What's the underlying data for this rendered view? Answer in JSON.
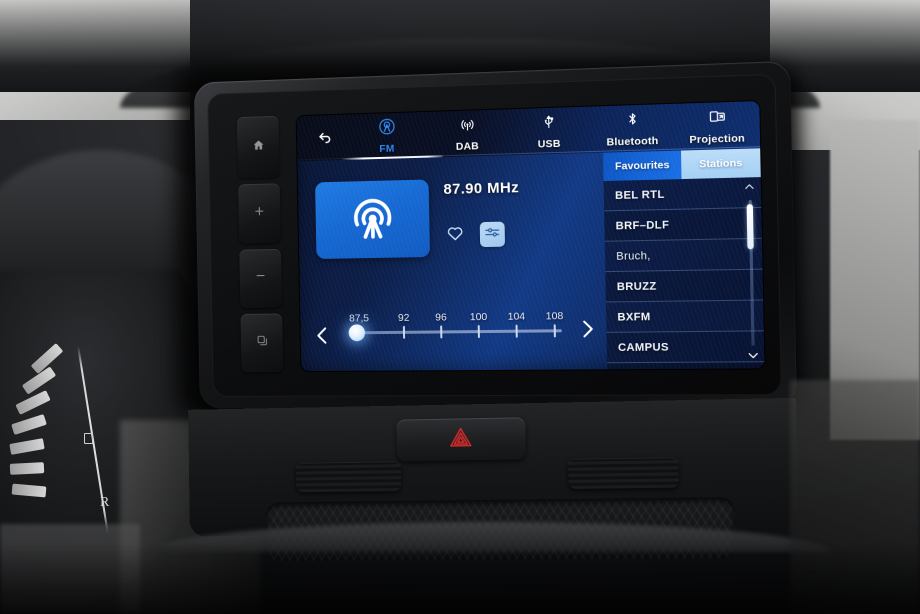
{
  "device": {
    "name": "car-infotainment-head-unit",
    "bezel_buttons": [
      {
        "name": "home",
        "glyph": "home-icon"
      },
      {
        "name": "volume-up",
        "glyph": "plus-icon"
      },
      {
        "name": "volume-down",
        "glyph": "minus-icon"
      },
      {
        "name": "apps",
        "glyph": "apps-icon"
      }
    ]
  },
  "screen": {
    "background_color": "#0c1d46",
    "accent_color": "#1a6ee4",
    "active_tab_color": "#a4cff4",
    "back_label": "Back",
    "sources": [
      {
        "id": "fm",
        "label": "FM",
        "icon": "broadcast-icon",
        "active": true
      },
      {
        "id": "dab",
        "label": "DAB",
        "icon": "antenna-icon",
        "active": false
      },
      {
        "id": "usb",
        "label": "USB",
        "icon": "usb-icon",
        "active": false
      },
      {
        "id": "bluetooth",
        "label": "Bluetooth",
        "icon": "bluetooth-icon",
        "active": false
      },
      {
        "id": "projection",
        "label": "Projection",
        "icon": "projection-icon",
        "active": false
      }
    ],
    "now_playing": {
      "frequency": "87.90 MHz",
      "artwork_icon": "radio-tower-icon",
      "favourite_icon": "heart-icon",
      "equalizer_icon": "audio-settings-icon"
    },
    "tuner": {
      "prev_label": "Previous station",
      "next_label": "Next station",
      "ticks": [
        "87,5",
        "92",
        "96",
        "100",
        "104",
        "108"
      ],
      "knob_position_label": "87,5"
    },
    "list": {
      "tabs": [
        {
          "id": "favourites",
          "label": "Favourites",
          "active": false
        },
        {
          "id": "stations",
          "label": "Stations",
          "active": true
        }
      ],
      "scroll_up_label": "Scroll up",
      "scroll_down_label": "Scroll down",
      "stations": [
        {
          "name": "BEL RTL",
          "soft": false
        },
        {
          "name": "BRF–DLF",
          "soft": false
        },
        {
          "name": "Bruch,",
          "soft": true
        },
        {
          "name": "BRUZZ",
          "soft": false
        },
        {
          "name": "BXFM",
          "soft": false
        },
        {
          "name": "CAMPUS",
          "soft": false
        }
      ]
    }
  },
  "dashboard": {
    "hazard_label": "Hazard warning lights",
    "hazard_color": "#d32b2b",
    "cluster": {
      "reserve_label": "R"
    }
  }
}
